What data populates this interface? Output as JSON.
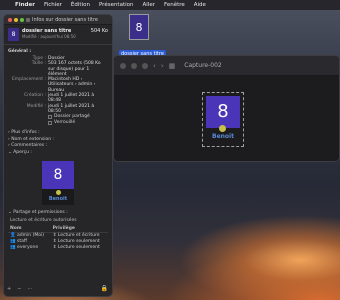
{
  "menubar": {
    "apple": "",
    "items": [
      "Finder",
      "Fichier",
      "Édition",
      "Présentation",
      "Aller",
      "Fenêtre",
      "Aide"
    ]
  },
  "desktop_icon": {
    "glyph": "8",
    "label": "dossier sans titre"
  },
  "finder": {
    "title": "Capture-002",
    "item": {
      "glyph": "8",
      "name": "Benoit"
    }
  },
  "info": {
    "window_title": "Infos sur dossier sans titre",
    "name": "dossier sans titre",
    "size_short": "504 Ko",
    "modified_short": "Modifié : aujourd'hui 08:50",
    "general_title": "Général :",
    "rows": [
      {
        "k": "Type :",
        "v": "Dossier"
      },
      {
        "k": "Taille :",
        "v": "503 167 octets (508 Ko sur disque) pour 1 élément"
      },
      {
        "k": "Emplacement :",
        "v": "Macintosh HD › Utilisateurs › admin › Bureau"
      },
      {
        "k": "Création :",
        "v": "jeudi 1 juillet 2021 à 08:48"
      },
      {
        "k": "Modifié :",
        "v": "jeudi 1 juillet 2021 à 08:50"
      }
    ],
    "shared_label": "Dossier partagé",
    "locked_label": "Verrouillé",
    "sections": [
      "Plus d'infos :",
      "Nom et extension :",
      "Commentaires :"
    ],
    "preview_title": "Aperçu :",
    "preview": {
      "glyph": "8",
      "name": "Benoit"
    },
    "permissions_title": "Partage et permissions :",
    "permissions_note": "Lecture et écriture autorisées",
    "perm_headers": [
      "Nom",
      "Privilège"
    ],
    "perm_rows": [
      {
        "name": "admin (Moi)",
        "priv": "Lecture et écriture"
      },
      {
        "name": "staff",
        "priv": "Lecture seulement"
      },
      {
        "name": "everyone",
        "priv": "Lecture seulement"
      }
    ],
    "bottom_buttons": [
      "+",
      "−",
      "⋯"
    ]
  },
  "colors": {
    "accent": "#2a5bd7",
    "folder_purple": "#4a35b8",
    "name_blue": "#5a8ad8"
  }
}
